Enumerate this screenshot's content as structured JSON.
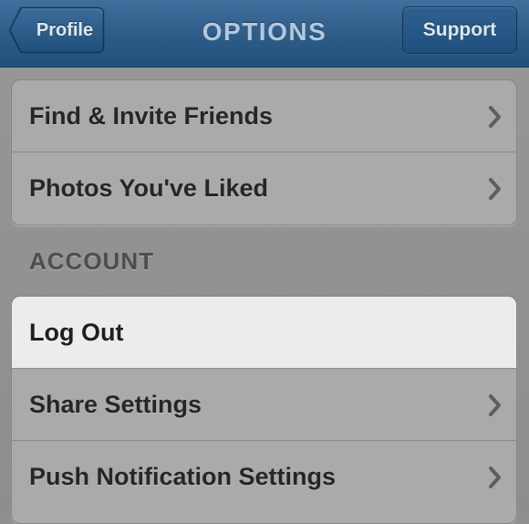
{
  "navbar": {
    "title": "OPTIONS",
    "back_label": "Profile",
    "right_label": "Support"
  },
  "group1": {
    "items": [
      {
        "label": "Find & Invite Friends",
        "chevron": "chevron-right-icon"
      },
      {
        "label": "Photos You've Liked",
        "chevron": "chevron-right-icon"
      }
    ]
  },
  "account": {
    "header": "ACCOUNT",
    "items": [
      {
        "label": "Log Out",
        "highlighted": true
      },
      {
        "label": "Share Settings",
        "chevron": "chevron-right-icon"
      },
      {
        "label": "Push Notification Settings",
        "chevron": "chevron-right-icon"
      }
    ]
  },
  "colors": {
    "navbar": "#2d5c88",
    "background": "#8f8f8f",
    "cell": "#aaaaaa",
    "highlight": "#ececec"
  }
}
